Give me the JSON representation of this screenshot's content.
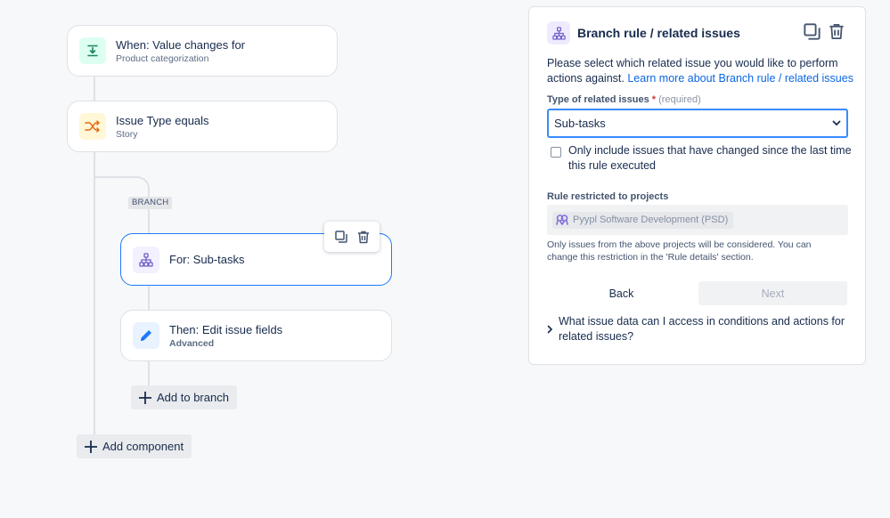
{
  "flow": {
    "trigger": {
      "title": "When: Value changes for",
      "subtitle": "Product categorization"
    },
    "condition": {
      "title": "Issue Type equals",
      "subtitle": "Story"
    },
    "branch_tag": "BRANCH",
    "branch_node": {
      "title": "For: Sub-tasks"
    },
    "action": {
      "title": "Then: Edit issue fields",
      "subtitle": "Advanced"
    },
    "add_to_branch_label": "Add to branch",
    "add_component_label": "Add component"
  },
  "panel": {
    "title": "Branch rule / related issues",
    "description": "Please select which related issue you would like to perform actions against.",
    "learn_more_link": "Learn more about Branch rule / related issues",
    "type_label": "Type of related issues",
    "required_marker": "*",
    "required_hint": "(required)",
    "type_value": "Sub-tasks",
    "checkbox_label": "Only include issues that have changed since the last time this rule executed",
    "checkbox_checked": false,
    "projects_label": "Rule restricted to projects",
    "project_chip": "Pyypl Software Development (PSD)",
    "projects_note": "Only issues from the above projects will be considered. You can change this restriction in the 'Rule details' section.",
    "back_label": "Back",
    "next_label": "Next",
    "faq_label": "What issue data can I access in conditions and actions for related issues?"
  },
  "colors": {
    "accent": "#1d7afc",
    "link": "#0c66e4",
    "trigger_icon_bg": "#dcfff1",
    "condition_icon_bg": "#fff7d6",
    "branch_icon_bg": "#f3f0ff",
    "action_icon_bg": "#e9f2ff"
  }
}
